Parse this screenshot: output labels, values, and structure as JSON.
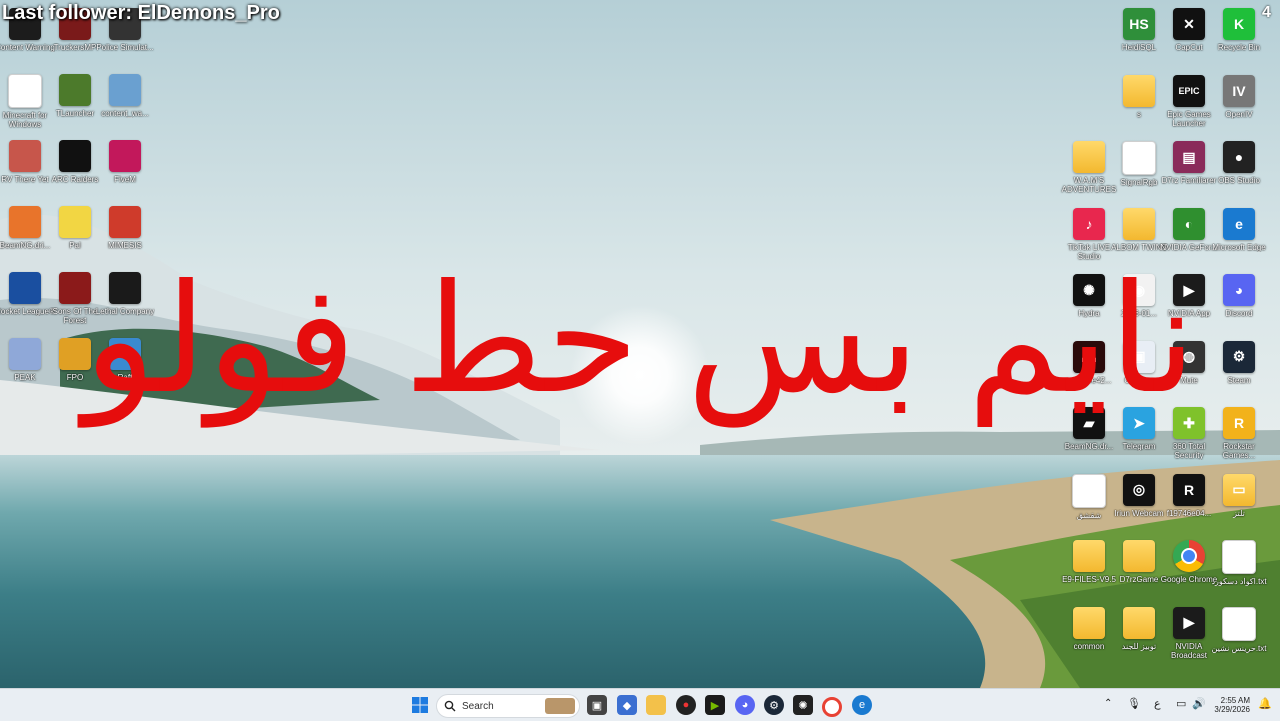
{
  "overlay": {
    "follower_text": "Last follower: ElDemons_Pro",
    "arabic_text": "نايم بس حط فولو"
  },
  "desktop": {
    "left_icons": [
      {
        "label": "Content Warning",
        "icon": "content-warning-icon",
        "color": "#1c1c1c"
      },
      {
        "label": "TruckersMP",
        "icon": "truckersmp-icon",
        "color": "#7a1a1a"
      },
      {
        "label": "Police Simulat...",
        "icon": "police-simulator-icon",
        "color": "#333333"
      },
      {
        "label": "Minecraft for Windows",
        "icon": "document-icon",
        "color": "#ffffff"
      },
      {
        "label": "TLauncher",
        "icon": "tlauncher-icon",
        "color": "#4c7a2b"
      },
      {
        "label": "content_wa...",
        "icon": "content-warning-icon",
        "color": "#6aa0d0"
      },
      {
        "label": "RV There Yet",
        "icon": "rv-there-yet-icon",
        "color": "#c7564b"
      },
      {
        "label": "ARC Raiders",
        "icon": "arc-raiders-icon",
        "color": "#111111"
      },
      {
        "label": "FiveM",
        "icon": "fivem-icon",
        "color": "#c2185b"
      },
      {
        "label": "BeamNG.dri...",
        "icon": "beamng-icon",
        "color": "#e8742b"
      },
      {
        "label": "Pal",
        "icon": "pal-icon",
        "color": "#f2d643"
      },
      {
        "label": "MIMESIS",
        "icon": "mimesis-icon",
        "color": "#cf3b2b"
      },
      {
        "label": "Rocket League®",
        "icon": "rocket-league-icon",
        "color": "#1a4fa0"
      },
      {
        "label": "Sons Of The Forest",
        "icon": "sons-of-the-forest-icon",
        "color": "#8b1a1a"
      },
      {
        "label": "Lethal Company",
        "icon": "lethal-company-icon",
        "color": "#1a1a1a"
      },
      {
        "label": "PEAK",
        "icon": "peak-icon",
        "color": "#8fa8d8"
      },
      {
        "label": "FPO",
        "icon": "fpo-icon",
        "color": "#e0a024"
      },
      {
        "label": "Raft",
        "icon": "raft-icon",
        "color": "#3a8ad0"
      }
    ],
    "right_icons": [
      {
        "label": "HeidiSQL",
        "icon": "heidisql-icon",
        "color": "#2f8f3a",
        "text": "HS"
      },
      {
        "label": "CapCut",
        "icon": "capcut-icon",
        "color": "#111111",
        "text": "✕"
      },
      {
        "label": "Recycle Bin",
        "icon": "recycle-bin-icon",
        "color": "#1fbf3a",
        "text": "K"
      },
      {
        "label": "s",
        "icon": "folder-icon",
        "color": "#f3c14a",
        "text": ""
      },
      {
        "label": "Epic Games Launcher",
        "icon": "epic-games-icon",
        "color": "#111111",
        "text": "EPIC"
      },
      {
        "label": "OpenIV",
        "icon": "openiv-icon",
        "color": "#777777",
        "text": "IV"
      },
      {
        "label": "W.A.M'S ADVENTURES",
        "icon": "folder-icon",
        "color": "#f3c14a",
        "text": ""
      },
      {
        "label": "SignalRgb",
        "icon": "document-icon",
        "color": "#ffffff",
        "text": ""
      },
      {
        "label": "D7rz Familiarer",
        "icon": "rar-icon",
        "color": "#8a2b5a",
        "text": "▤"
      },
      {
        "label": "OBS Studio",
        "icon": "obs-icon",
        "color": "#222222",
        "text": "●"
      },
      {
        "label": "TikTok LIVE Studio",
        "icon": "tiktok-icon",
        "color": "#e8274e",
        "text": "♪"
      },
      {
        "label": "ALBOM TWINS",
        "icon": "folder-icon",
        "color": "#f3c14a",
        "text": ""
      },
      {
        "label": "NVIDIA GeFor...",
        "icon": "nvidia-icon",
        "color": "#2f8f2f",
        "text": "◐"
      },
      {
        "label": "Microsoft Edge",
        "icon": "edge-icon",
        "color": "#1a7ad0",
        "text": "e"
      },
      {
        "label": "Hydra",
        "icon": "hydra-icon",
        "color": "#111111",
        "text": "✺"
      },
      {
        "label": "2026-01...",
        "icon": "video-file-icon",
        "color": "#f2f2f2",
        "text": "◉"
      },
      {
        "label": "NVIDIA App",
        "icon": "nvidia-app-icon",
        "color": "#1b1b1b",
        "text": "▶"
      },
      {
        "label": "Discord",
        "icon": "discord-icon",
        "color": "#5865f2",
        "text": "◕"
      },
      {
        "label": "ree5e5e42...",
        "icon": "image-file-icon",
        "color": "#2a0a0a",
        "text": "▬"
      },
      {
        "label": "CApture",
        "icon": "capture-icon",
        "color": "#e8eef5",
        "text": "▣"
      },
      {
        "label": "Mute",
        "icon": "headset-icon",
        "color": "#333333",
        "text": "◍"
      },
      {
        "label": "Steam",
        "icon": "steam-icon",
        "color": "#1b2838",
        "text": "⚙"
      },
      {
        "label": "BeamNG.dr...",
        "icon": "beamng-shortcut-icon",
        "color": "#111111",
        "text": "▰"
      },
      {
        "label": "Telegram",
        "icon": "telegram-icon",
        "color": "#2aa3e0",
        "text": "➤"
      },
      {
        "label": "360 Total Security",
        "icon": "security-icon",
        "color": "#7fc22b",
        "text": "✚"
      },
      {
        "label": "Rockstar Games...",
        "icon": "rockstar-icon",
        "color": "#f2b21b",
        "text": "R"
      },
      {
        "label": "شقشق",
        "icon": "document-icon",
        "color": "#ffffff",
        "text": ""
      },
      {
        "label": "Iriun Webcam",
        "icon": "iriun-icon",
        "color": "#111111",
        "text": "◎"
      },
      {
        "label": "f19746e04...",
        "icon": "r-app-icon",
        "color": "#111111",
        "text": "R"
      },
      {
        "label": "تلتز",
        "icon": "archive-icon",
        "color": "#f3c14a",
        "text": "▭"
      },
      {
        "label": "E9-FILES-V9.5",
        "icon": "folder-icon",
        "color": "#f3c14a",
        "text": ""
      },
      {
        "label": "D7rzGame",
        "icon": "folder-icon",
        "color": "#f3c14a",
        "text": ""
      },
      {
        "label": "Google Chrome",
        "icon": "chrome-icon",
        "color": "#ffffff",
        "text": ""
      },
      {
        "label": "اكواد دسكورد.txt",
        "icon": "text-file-icon",
        "color": "#ffffff",
        "text": ""
      },
      {
        "label": "common",
        "icon": "folder-icon",
        "color": "#f3c14a",
        "text": ""
      },
      {
        "label": "توبيز للجند",
        "icon": "folder-icon",
        "color": "#f3c14a",
        "text": ""
      },
      {
        "label": "NVIDIA Broadcast",
        "icon": "nvidia-broadcast-icon",
        "color": "#1b1b1b",
        "text": "▶"
      },
      {
        "label": "حرينس نشين.txt",
        "icon": "text-file-icon",
        "color": "#ffffff",
        "text": ""
      }
    ],
    "recycle_badge": "4"
  },
  "taskbar": {
    "search_placeholder": "Search",
    "time": "2:55 AM",
    "date": "3/29/2026",
    "lang": "ع"
  }
}
